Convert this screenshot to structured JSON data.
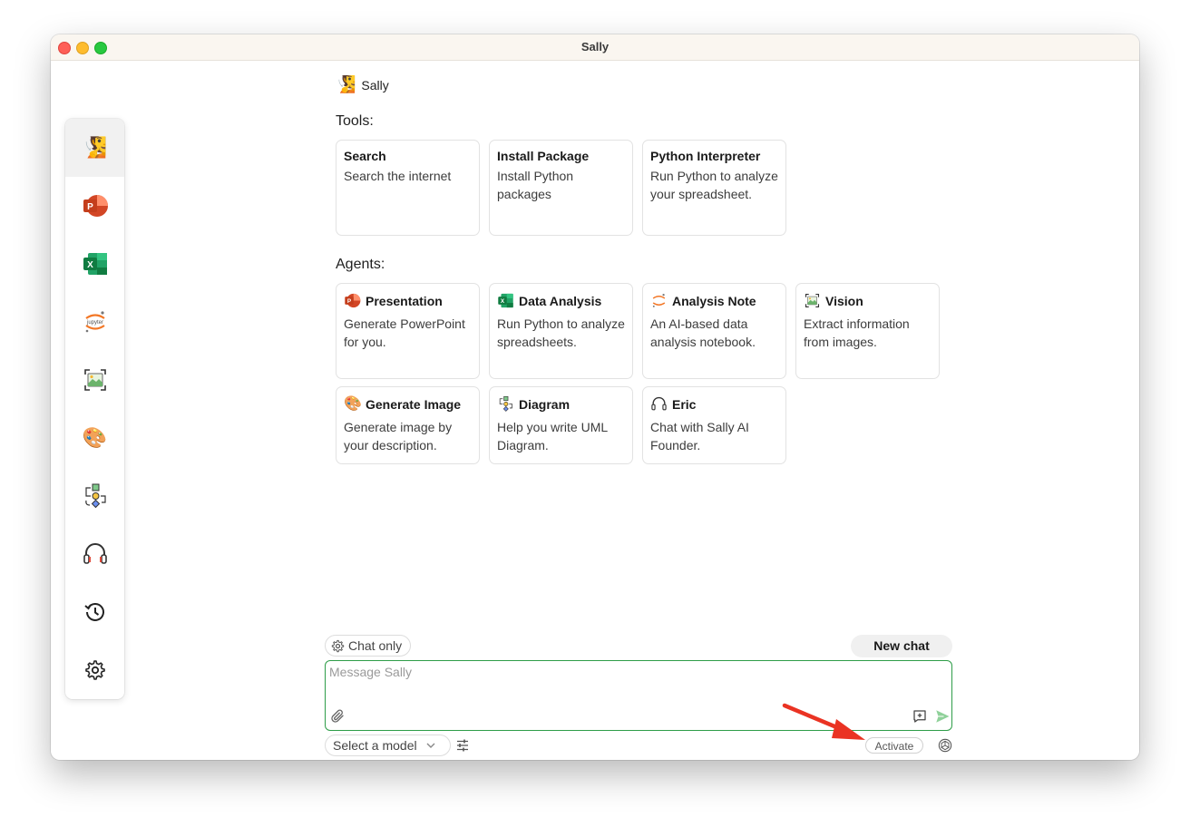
{
  "window": {
    "title": "Sally"
  },
  "sidebar": {
    "items": [
      {
        "name": "sally-avatar",
        "emoji": "🧏"
      },
      {
        "name": "powerpoint"
      },
      {
        "name": "excel"
      },
      {
        "name": "jupyter",
        "label": "jupyter"
      },
      {
        "name": "vision"
      },
      {
        "name": "palette",
        "emoji": "🎨"
      },
      {
        "name": "diagram"
      },
      {
        "name": "headphones",
        "emoji": "🎧"
      },
      {
        "name": "history"
      },
      {
        "name": "settings"
      }
    ]
  },
  "agent": {
    "emoji": "🧏",
    "name": "Sally"
  },
  "tools": {
    "label": "Tools:",
    "items": [
      {
        "title": "Search",
        "desc": "Search the internet"
      },
      {
        "title": "Install Package",
        "desc": "Install Python packages"
      },
      {
        "title": "Python Interpreter",
        "desc": "Run Python to analyze your spreadsheet."
      }
    ]
  },
  "agents": {
    "label": "Agents:",
    "items": [
      {
        "title": "Presentation",
        "desc": "Generate PowerPoint for you.",
        "icon": "powerpoint-icon"
      },
      {
        "title": "Data Analysis",
        "desc": "Run Python to analyze spreadsheets.",
        "icon": "excel-icon"
      },
      {
        "title": "Analysis Note",
        "desc": "An AI-based data analysis notebook.",
        "icon": "jupyter-icon"
      },
      {
        "title": "Vision",
        "desc": "Extract information from images.",
        "icon": "vision-icon"
      },
      {
        "title": "Generate Image",
        "desc": "Generate image by your description.",
        "icon": "palette-icon",
        "emoji": "🎨"
      },
      {
        "title": "Diagram",
        "desc": "Help you write UML Diagram.",
        "icon": "diagram-icon"
      },
      {
        "title": "Eric",
        "desc": "Chat with Sally AI Founder.",
        "icon": "headphones-icon",
        "emoji": "🎧"
      }
    ]
  },
  "composer": {
    "chat_only_label": "Chat only",
    "new_chat_label": "New chat",
    "placeholder": "Message Sally",
    "model_select_label": "Select a model",
    "activate_label": "Activate"
  },
  "colors": {
    "accent_green": "#2e9d48",
    "arrow_red": "#ea3323",
    "send_green": "#8fd19a"
  }
}
